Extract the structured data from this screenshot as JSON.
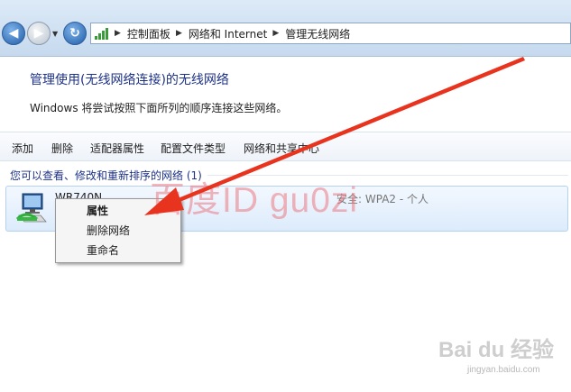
{
  "address_bar": {
    "breadcrumbs": [
      "控制面板",
      "网络和 Internet",
      "管理无线网络"
    ]
  },
  "main": {
    "heading": "管理使用(无线网络连接)的无线网络",
    "description": "Windows 将尝试按照下面所列的顺序连接这些网络。"
  },
  "toolbar": {
    "items": [
      "添加",
      "删除",
      "适配器属性",
      "配置文件类型",
      "网络和共享中心"
    ]
  },
  "network_list": {
    "group_header": "您可以查看、修改和重新排序的网络 (1)",
    "networks": [
      {
        "name": "WR740N",
        "security": "安全: WPA2 - 个人"
      }
    ]
  },
  "context_menu": {
    "items": [
      "属性",
      "删除网络",
      "重命名"
    ]
  },
  "overlays": {
    "watermark": "百度ID gu0zi",
    "baidu_logo": "Bai du 经验",
    "baidu_url": "jingyan.baidu.com",
    "arrow_color": "#e8331e"
  },
  "colors": {
    "heading": "#1e3287",
    "selection": "#dcebfc"
  }
}
